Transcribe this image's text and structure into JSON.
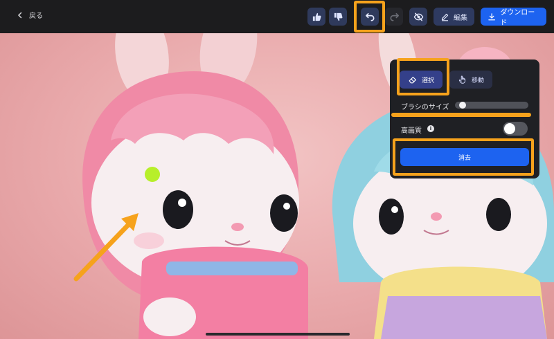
{
  "topbar": {
    "back_label": "戻る",
    "icons": {
      "thumbs_up": "thumbs-up-icon",
      "thumbs_down": "thumbs-down-icon",
      "undo": "undo-icon",
      "redo": "redo-icon",
      "hide": "eye-off-icon"
    },
    "edit_label": "編集",
    "download_label": "ダウンロード"
  },
  "panel": {
    "select_label": "選択",
    "move_label": "移動",
    "brush_size_label": "ブラシのサイズ",
    "brush_size_value": 0.06,
    "hq_label": "高画質",
    "hq_enabled": false,
    "erase_label": "消去"
  },
  "colors": {
    "accent": "#1d63f0",
    "highlight": "#f6a21c",
    "brush_dot": "#b7ef2a"
  }
}
